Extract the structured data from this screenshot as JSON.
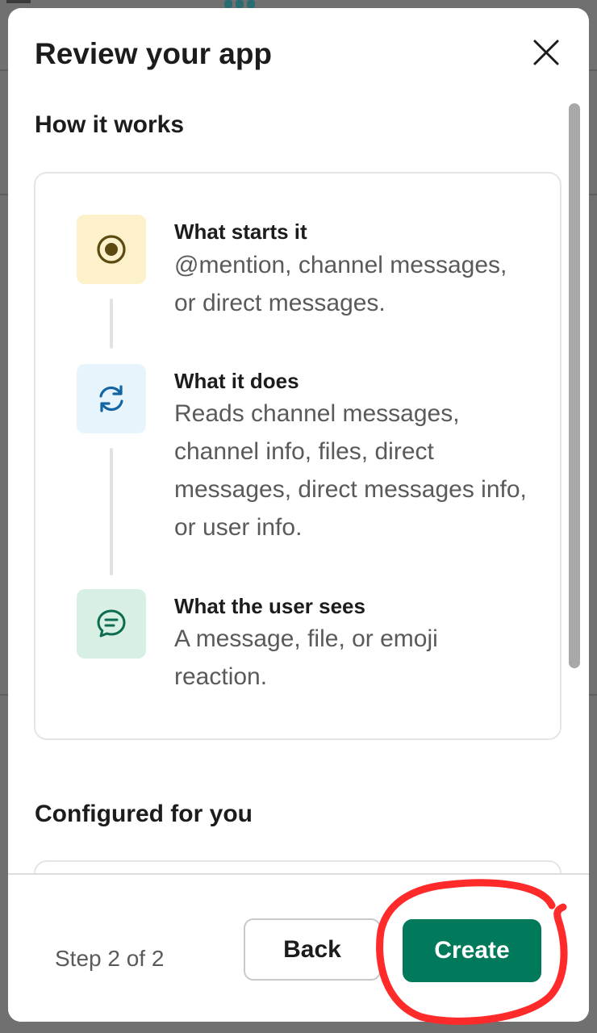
{
  "modal": {
    "title": "Review your app",
    "close_icon": "close-icon"
  },
  "how_it_works": {
    "title": "How it works",
    "steps": [
      {
        "icon": "target-icon",
        "icon_bg": "#fdf1cc",
        "icon_color": "#5c4a10",
        "heading": "What starts it",
        "text": "@mention, channel messages, or direct messages."
      },
      {
        "icon": "refresh-icon",
        "icon_bg": "#e8f4fc",
        "icon_color": "#1264a3",
        "heading": "What it does",
        "text": "Reads channel messages, channel info, files, direct messages, direct messages info, or user info."
      },
      {
        "icon": "message-icon",
        "icon_bg": "#d8f0e4",
        "icon_color": "#0c6b50",
        "heading": "What the user sees",
        "text": "A message, file, or emoji reaction."
      }
    ]
  },
  "configured": {
    "title": "Configured for you"
  },
  "footer": {
    "step_label": "Step 2 of 2",
    "back_label": "Back",
    "create_label": "Create"
  },
  "colors": {
    "primary": "#007a5a",
    "annotation": "#ff2a2a"
  }
}
